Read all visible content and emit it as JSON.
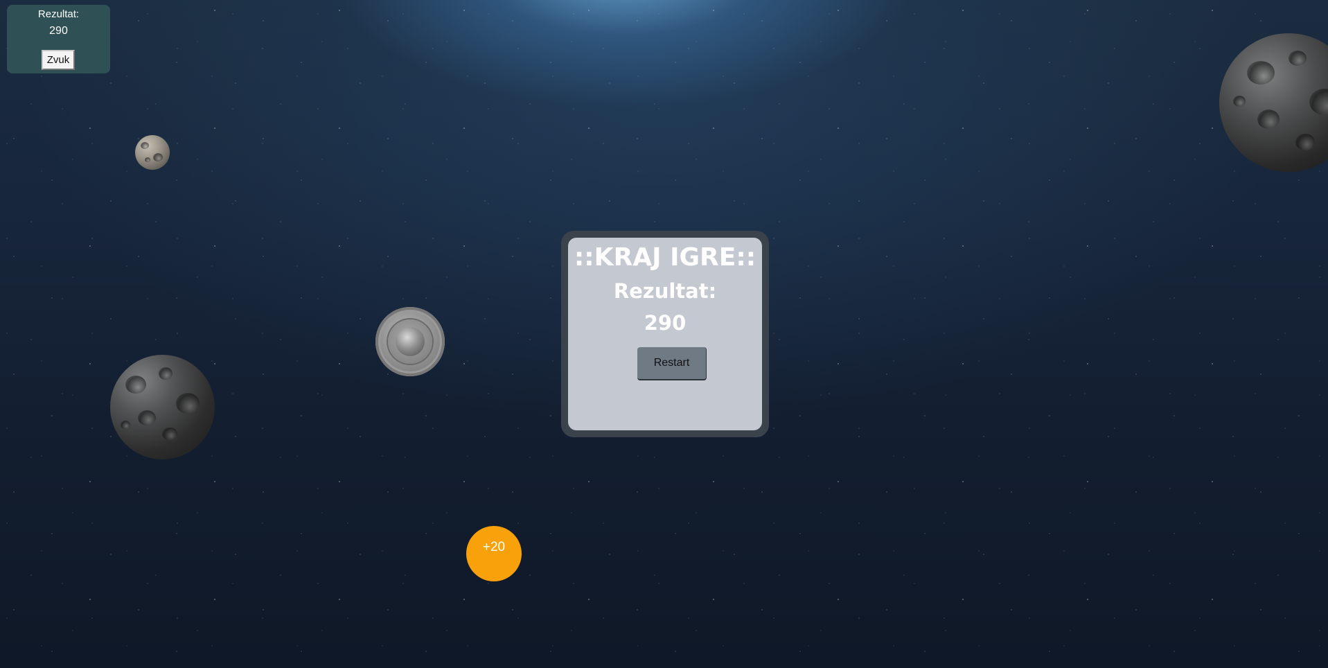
{
  "hud": {
    "score_label": "Rezultat:",
    "score_value": "290",
    "sound_button_label": "Zvuk"
  },
  "game_over": {
    "title": "::KRAJ IGRE::",
    "score_label": "Rezultat:",
    "score_value": "290",
    "restart_label": "Restart"
  },
  "bonus": {
    "label": "+20",
    "color": "#f9a10a"
  },
  "colors": {
    "hud_panel": "#2f5156",
    "modal_frame": "#3a434c",
    "modal_body": "#c4c8d0",
    "restart_button": "#6f7a85"
  },
  "sprites": [
    "player-ship",
    "asteroid",
    "asteroid",
    "asteroid",
    "bonus-token"
  ]
}
